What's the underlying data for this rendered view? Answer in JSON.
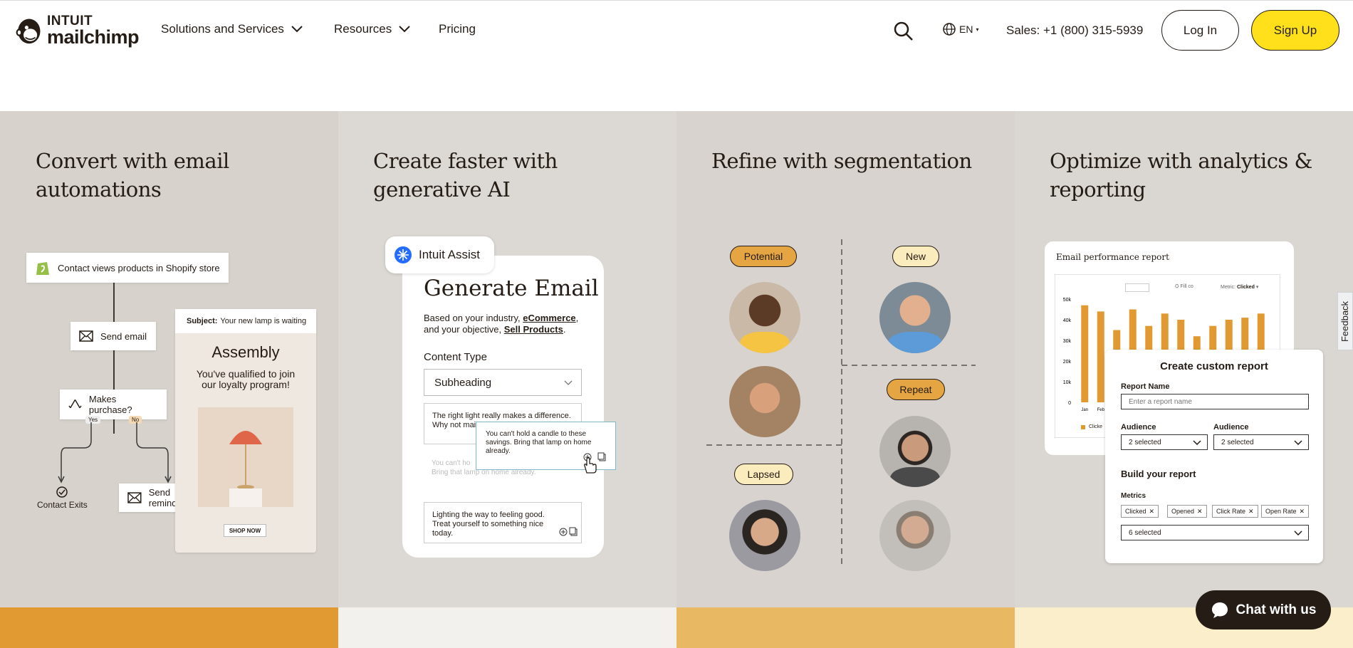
{
  "nav": {
    "logo_line1": "INTUIT",
    "logo_line2": "mailchimp",
    "solutions": "Solutions and Services",
    "resources": "Resources",
    "pricing": "Pricing",
    "lang": "EN",
    "sales": "Sales: +1 (800) 315-5939",
    "login": "Log In",
    "signup": "Sign Up"
  },
  "features": [
    {
      "title": "Convert with email automations"
    },
    {
      "title": "Create faster with generative AI"
    },
    {
      "title": "Refine with segmentation"
    },
    {
      "title": "Optimize with analytics & reporting"
    }
  ],
  "automation": {
    "trigger": "Contact views products in Shopify store",
    "send_email": "Send email",
    "purchase": "Makes purchase?",
    "yes": "Yes",
    "no": "No",
    "exits": "Contact Exits",
    "reminder": "Send reminder",
    "subject_label": "Subject:",
    "subject_text": "Your new lamp is waiting",
    "brand": "Assembly",
    "promo": "You've qualified to join our loyalty program!",
    "shop_now": "SHOP NOW"
  },
  "ai": {
    "assist": "Intuit Assist",
    "heading": "Generate Email",
    "desc_pre": "Based on your industry, ",
    "industry": "eCommerce",
    "desc_mid": ", and your objective, ",
    "objective": "Sell Products",
    "desc_end": ".",
    "content_type_label": "Content Type",
    "content_type_value": "Subheading",
    "option1": "The right light really makes a difference. Why not mai",
    "option2": "You can't ho",
    "option2b": "Bring that lamp on home already.",
    "option3": "Lighting the way to feeling good. Treat yourself to something nice today.",
    "tooltip": "You can't hold a candle to these savings. Bring that lamp on home already."
  },
  "segments": {
    "potential": "Potential",
    "new": "New",
    "repeat": "Repeat",
    "lapsed": "Lapsed"
  },
  "report": {
    "title": "Email performance report",
    "metric_label": "Metric:",
    "metric_value": "Clicked",
    "fill_label": "Fill co",
    "legend": "Clicke",
    "y_ticks": [
      "50k",
      "40k",
      "30k",
      "20k",
      "10k",
      "0"
    ],
    "x_ticks": [
      "Jan",
      "Feb"
    ]
  },
  "chart_data": {
    "type": "bar",
    "title": "Email performance report",
    "ylim": [
      0,
      50000
    ],
    "values": [
      47000,
      44000,
      35000,
      45000,
      37000,
      43000,
      40000,
      32000,
      37000,
      40000,
      41000,
      43000
    ],
    "series": [
      {
        "name": "Clicke",
        "values": [
          47000,
          44000,
          35000,
          45000,
          37000,
          43000,
          40000,
          32000,
          37000,
          40000,
          41000,
          43000
        ]
      }
    ]
  },
  "custom": {
    "title": "Create custom report",
    "name_label": "Report Name",
    "name_placeholder": "Enter a report name",
    "aud_label1": "Audience",
    "aud_value1": "2 selected",
    "aud_label2": "Audience",
    "aud_value2": "2 selected",
    "build": "Build your report",
    "metrics_label": "Metrics",
    "chips": [
      "Clicked",
      "Opened",
      "Click Rate",
      "Open Rate"
    ],
    "metrics_value": "6 selected"
  },
  "feedback": "Feedback",
  "chat": "Chat with us",
  "colors": {
    "yellow": "#ffe01b",
    "strip1": "#e09a31",
    "strip2": "#f3f1ee",
    "strip3": "#e9b862",
    "strip4": "#fbeecb",
    "bar": "#e09a31"
  }
}
